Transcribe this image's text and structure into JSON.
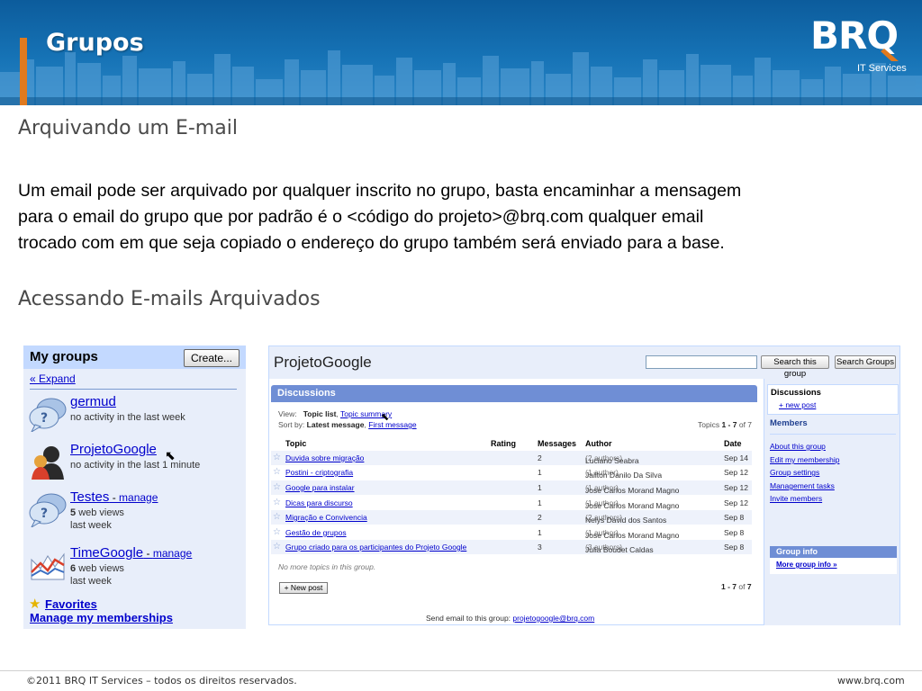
{
  "slide": {
    "title": "Grupos",
    "logo_text": "BRQ",
    "logo_sub": "IT Services",
    "brand_colors": {
      "blue": "#1673b6",
      "orange": "#e07a1f"
    }
  },
  "content": {
    "heading1": "Arquivando um E-mail",
    "paragraph_lines": [
      "Um email pode ser arquivado por qualquer inscrito no grupo, basta encaminhar a mensagem",
      "para o email do grupo que por padrão é o <código do projeto>@brq.com qualquer email",
      "trocado com em que seja copiado o endereço do grupo também será enviado para a base."
    ],
    "heading2": "Acessando E-mails Arquivados"
  },
  "my_groups": {
    "title": "My groups",
    "create_button": "Create...",
    "expand_link": "« Expand",
    "groups": [
      {
        "name": "germud",
        "manage": "",
        "views": "",
        "line2": "no activity in the last week",
        "line3": "",
        "icon": "chat-bubble-icon"
      },
      {
        "name": "ProjetoGoogle",
        "manage": "",
        "views": "",
        "line2": "no activity in the last 1 minute",
        "line3": "",
        "icon": "user-avatar-icon"
      },
      {
        "name": "Testes",
        "manage": "manage",
        "views": "5",
        "line2": "web views",
        "line3": "last week",
        "icon": "chat-bubble-icon"
      },
      {
        "name": "TimeGoogle",
        "manage": "manage",
        "views": "6",
        "line2": "web views",
        "line3": "last week",
        "icon": "chart-icon"
      }
    ],
    "separator": " - ",
    "favorites": "Favorites",
    "manage_memberships": "Manage my memberships"
  },
  "group_page": {
    "title": "ProjetoGoogle",
    "search_this_group": "Search this group",
    "search_groups": "Search Groups",
    "discussions_bar": "Discussions",
    "view_label": "View:",
    "view_current": "Topic list",
    "view_alt": "Topic summary",
    "sort_label": "Sort by:",
    "sort_current": "Latest message",
    "sort_alt": "First message",
    "topics_count_prefix": "Topics ",
    "topics_range": "1 - 7",
    "topics_of": " of ",
    "topics_total": "7",
    "columns": [
      "Topic",
      "Rating",
      "Messages",
      "Author",
      "Date"
    ],
    "rows": [
      {
        "topic": "Duvida sobre migração",
        "messages": "2",
        "author": "Luciano Seabra",
        "authors_note": "(2 authors)",
        "date": "Sep 14"
      },
      {
        "topic": "Postini - criptografia",
        "messages": "1",
        "author": "Jailton Danilo Da Silva",
        "authors_note": "(1 author)",
        "date": "Sep 12"
      },
      {
        "topic": "Google para instalar",
        "messages": "1",
        "author": "Jose Carlos Morand Magno",
        "authors_note": "(1 author)",
        "date": "Sep 12"
      },
      {
        "topic": "Dicas para discurso",
        "messages": "1",
        "author": "Jose Carlos Morand Magno",
        "authors_note": "(1 author)",
        "date": "Sep 12"
      },
      {
        "topic": "Migração e Convivencia",
        "messages": "2",
        "author": "Nelys David dos Santos",
        "authors_note": "(2 authors)",
        "date": "Sep 8"
      },
      {
        "topic": "Gestão de grupos",
        "messages": "1",
        "author": "Jose Carlos Morand Magno",
        "authors_note": "(1 author)",
        "date": "Sep 8"
      },
      {
        "topic": "Grupo criado para os participantes do Projeto Google",
        "messages": "3",
        "author": "Julia Boudet Caldas",
        "authors_note": "(3 authors)",
        "date": "Sep 8"
      }
    ],
    "no_more": "No more topics in this group.",
    "new_post_button": "+ New post",
    "bottom_range": "1 - 7",
    "bottom_of": " of ",
    "bottom_total": "7",
    "send_email_label": "Send email to this group: ",
    "send_email_address": "projetogoogle@brq.com",
    "sidebar": {
      "discussions": "Discussions",
      "new_post": "+ new post",
      "members": "Members",
      "links": [
        "About this group",
        "Edit my membership",
        "Group settings",
        "Management tasks",
        "Invite members"
      ],
      "group_info": "Group info",
      "more_group_info": "More group info »"
    }
  },
  "footer": {
    "copyright": "©2011 BRQ IT Services – todos os direitos reservados.",
    "website": "www.brq.com"
  }
}
